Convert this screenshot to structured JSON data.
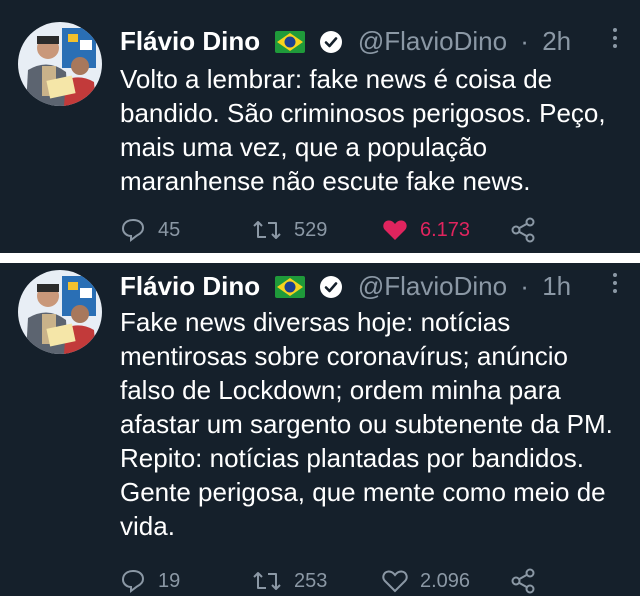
{
  "tweets": [
    {
      "name": "Flávio Dino",
      "handle": "@FlavioDino",
      "time": "2h",
      "text": "Volto a lembrar: fake news é coisa de bandido. São criminosos perigosos. Peço, mais uma vez, que a população maranhense não escute fake news.",
      "replies": "45",
      "retweets": "529",
      "likes": "6.173",
      "liked": true
    },
    {
      "name": "Flávio Dino",
      "handle": "@FlavioDino",
      "time": "1h",
      "text": "Fake news diversas hoje: notícias mentirosas sobre coronavírus; anúncio falso de Lockdown; ordem minha para afastar um sargento ou subtenente da PM. Repito: notícias plantadas por bandidos. Gente perigosa, que mente como meio de vida.",
      "replies": "19",
      "retweets": "253",
      "likes": "2.096",
      "liked": false
    }
  ],
  "separator": "·",
  "colors": {
    "background": "#15202b",
    "text": "#ffffff",
    "muted": "#8b98a5",
    "like": "#e0245e"
  },
  "icons": [
    "brazil-flag-icon",
    "verified-badge-icon",
    "more-options-icon",
    "reply-icon",
    "retweet-icon",
    "like-icon",
    "share-icon"
  ]
}
